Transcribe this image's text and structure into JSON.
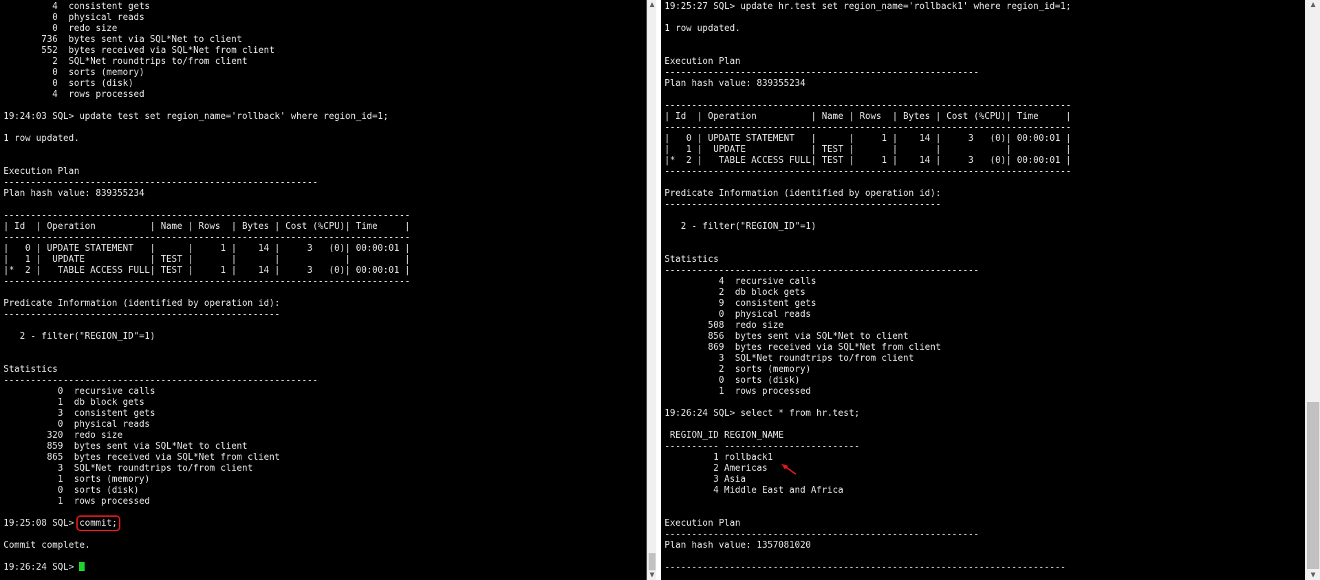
{
  "left_terminal": {
    "lines_before_cmd": [
      "         4  consistent gets",
      "         0  physical reads",
      "         0  redo size",
      "       736  bytes sent via SQL*Net to client",
      "       552  bytes received via SQL*Net from client",
      "         2  SQL*Net roundtrips to/from client",
      "         0  sorts (memory)",
      "         0  sorts (disk)",
      "         4  rows processed",
      "",
      "19:24:03 SQL> update test set region_name='rollback' where region_id=1;",
      "",
      "1 row updated.",
      "",
      "",
      "Execution Plan",
      "----------------------------------------------------------",
      "Plan hash value: 839355234",
      "",
      "---------------------------------------------------------------------------",
      "| Id  | Operation          | Name | Rows  | Bytes | Cost (%CPU)| Time     |",
      "---------------------------------------------------------------------------",
      "|   0 | UPDATE STATEMENT   |      |     1 |    14 |     3   (0)| 00:00:01 |",
      "|   1 |  UPDATE            | TEST |       |       |            |          |",
      "|*  2 |   TABLE ACCESS FULL| TEST |     1 |    14 |     3   (0)| 00:00:01 |",
      "---------------------------------------------------------------------------",
      "",
      "Predicate Information (identified by operation id):",
      "---------------------------------------------------",
      "",
      "   2 - filter(\"REGION_ID\"=1)",
      "",
      "",
      "Statistics",
      "----------------------------------------------------------",
      "          0  recursive calls",
      "          1  db block gets",
      "          3  consistent gets",
      "          0  physical reads",
      "        320  redo size",
      "        859  bytes sent via SQL*Net to client",
      "        865  bytes received via SQL*Net from client",
      "          3  SQL*Net roundtrips to/from client",
      "          1  sorts (memory)",
      "          0  sorts (disk)",
      "          1  rows processed",
      ""
    ],
    "commit_prompt": "19:25:08 SQL> ",
    "commit_cmd": "commit;",
    "lines_after_cmd": [
      "",
      "Commit complete.",
      ""
    ],
    "last_prompt": "19:26:24 SQL> "
  },
  "right_terminal": {
    "lines": [
      "19:25:27 SQL> update hr.test set region_name='rollback1' where region_id=1;",
      "",
      "1 row updated.",
      "",
      "",
      "Execution Plan",
      "----------------------------------------------------------",
      "Plan hash value: 839355234",
      "",
      "---------------------------------------------------------------------------",
      "| Id  | Operation          | Name | Rows  | Bytes | Cost (%CPU)| Time     |",
      "---------------------------------------------------------------------------",
      "|   0 | UPDATE STATEMENT   |      |     1 |    14 |     3   (0)| 00:00:01 |",
      "|   1 |  UPDATE            | TEST |       |       |            |          |",
      "|*  2 |   TABLE ACCESS FULL| TEST |     1 |    14 |     3   (0)| 00:00:01 |",
      "---------------------------------------------------------------------------",
      "",
      "Predicate Information (identified by operation id):",
      "---------------------------------------------------",
      "",
      "   2 - filter(\"REGION_ID\"=1)",
      "",
      "",
      "Statistics",
      "----------------------------------------------------------",
      "          4  recursive calls",
      "          2  db block gets",
      "          9  consistent gets",
      "          0  physical reads",
      "        508  redo size",
      "        856  bytes sent via SQL*Net to client",
      "        869  bytes received via SQL*Net from client",
      "          3  SQL*Net roundtrips to/from client",
      "          2  sorts (memory)",
      "          0  sorts (disk)",
      "          1  rows processed",
      "",
      "19:26:24 SQL> select * from hr.test;",
      "",
      " REGION_ID REGION_NAME",
      "---------- -------------------------",
      "         1 rollback1",
      "         2 Americas",
      "         3 Asia",
      "         4 Middle East and Africa",
      "",
      "",
      "Execution Plan",
      "----------------------------------------------------------",
      "Plan hash value: 1357081020",
      "",
      "--------------------------------------------------------------------------"
    ]
  },
  "colors": {
    "terminal_bg": "#000000",
    "terminal_fg": "#e6e6e6",
    "cursor": "#1ad62c",
    "highlight_box": "#e3191b",
    "scrollbar_track": "#f0f0f0",
    "scrollbar_thumb": "#c1c1c1"
  },
  "icons": {
    "annotation": "red-arrow-icon",
    "scroll_up": "chevron-up-icon",
    "scroll_down": "chevron-down-icon"
  }
}
